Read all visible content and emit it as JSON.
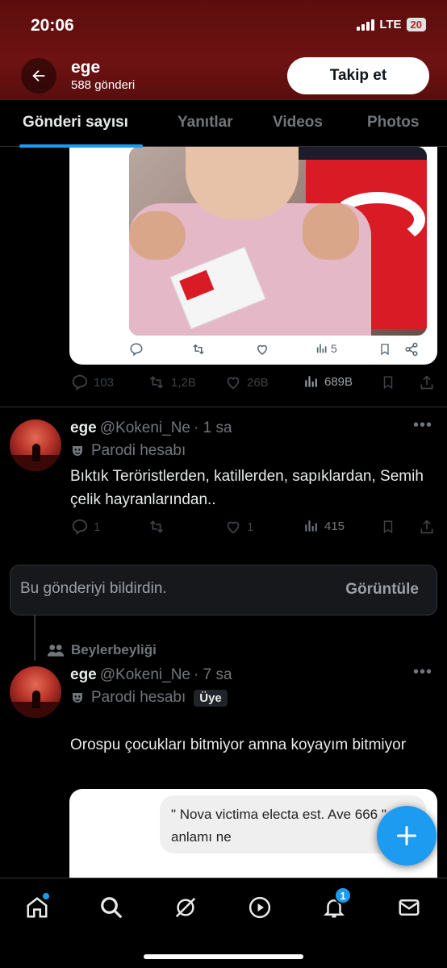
{
  "status_bar": {
    "time": "20:06",
    "network": "LTE",
    "battery": "20"
  },
  "profile": {
    "name": "ege",
    "post_count": "588 gönderi",
    "follow_label": "Takip et"
  },
  "tabs": [
    {
      "label": "Gönderi sayısı",
      "active": true
    },
    {
      "label": "Yanıtlar",
      "active": false
    },
    {
      "label": "Videos",
      "active": false
    },
    {
      "label": "Photos",
      "active": false
    }
  ],
  "quoted_card_1": {
    "view_count": "5"
  },
  "post_0": {
    "replies": "103",
    "reposts": "1,2B",
    "likes": "26B",
    "views": "689B"
  },
  "post_1": {
    "name": "ege",
    "handle": "@Kokeni_Ne",
    "time": "· 1 sa",
    "parody_label": "Parodi hesabı",
    "text": "Bıktık Teröristlerden, katillerden, sapıklardan, Semih çelik hayranlarından..",
    "replies": "1",
    "likes": "1",
    "views": "415"
  },
  "report_notice": {
    "text": "Bu gönderiyi bildirdin.",
    "button": "Görüntüle"
  },
  "community": {
    "name": "Beylerbeyliği"
  },
  "post_2": {
    "name": "ege",
    "handle": "@Kokeni_Ne",
    "time": "· 7 sa",
    "parody_label": "Parodi hesabı",
    "member_badge": "Üye",
    "text": "Orospu çocukları bitmiyor amna koyayım bitmiyor",
    "quoted_text": "\" Nova victima electa est. Ave 666 \" anlamı ne"
  },
  "nav": {
    "notifications_badge": "1"
  },
  "colors": {
    "accent": "#1d9bf0",
    "header_bg": "#6e1212",
    "text_secondary": "#71767b"
  },
  "icons": [
    "back-arrow-icon",
    "reply-icon",
    "repost-icon",
    "like-icon",
    "views-icon",
    "bookmark-icon",
    "share-icon",
    "parody-mask-icon",
    "community-icon",
    "compose-plus-icon",
    "home-icon",
    "search-icon",
    "grok-icon",
    "play-icon",
    "bell-icon",
    "mail-icon"
  ]
}
